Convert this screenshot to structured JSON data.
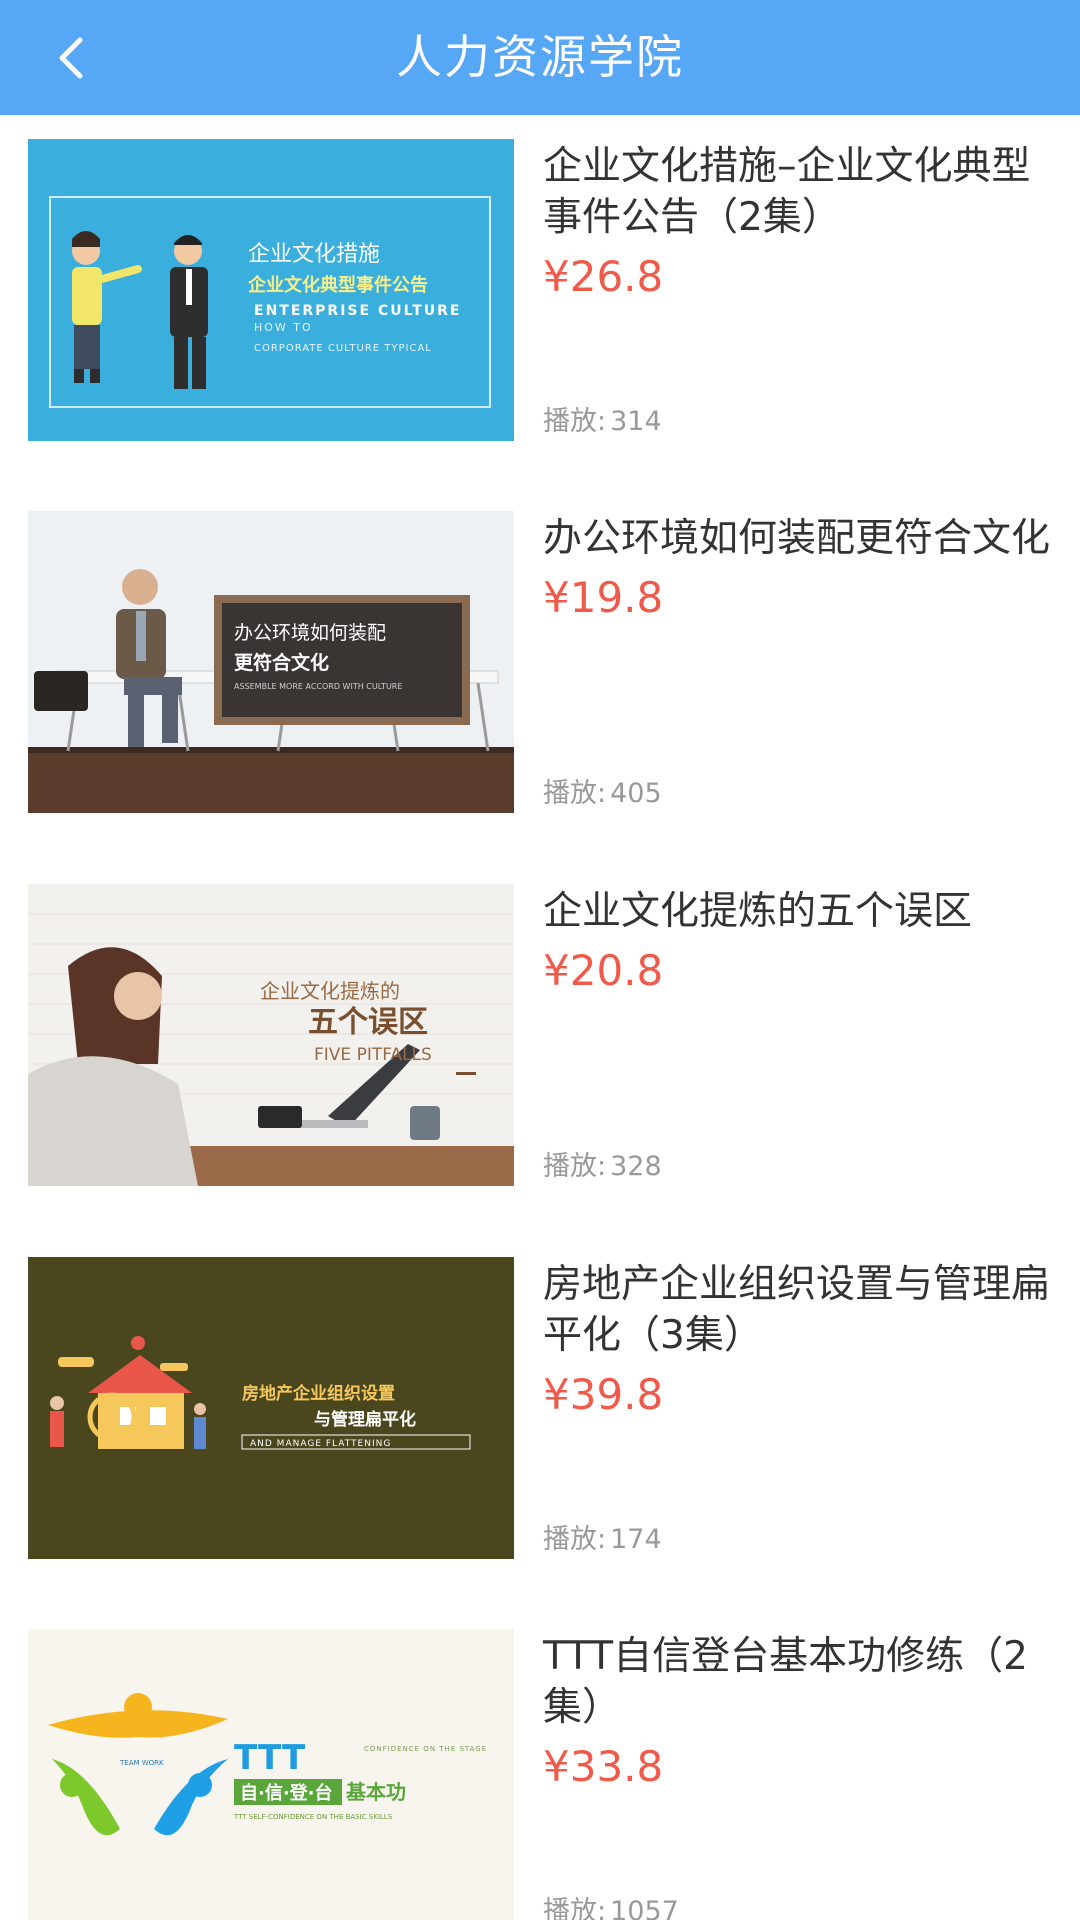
{
  "header": {
    "title": "人力资源学院",
    "back_icon": "chevron-left-icon",
    "background": "#57a7f7"
  },
  "play_label": "播放:",
  "price_color": "#f05a4a",
  "courses": [
    {
      "title": "企业文化措施–企业文化典型事件公告（2集）",
      "price": "¥26.8",
      "plays": "314",
      "thumb_text": {
        "line1": "企业文化措施",
        "line2": "企业文化典型事件公告",
        "line3": "ENTERPRISE CULTURE",
        "line4": "HOW TO",
        "line5": "CORPORATE CULTURE TYPICAL"
      }
    },
    {
      "title": "办公环境如何装配更符合文化",
      "price": "¥19.8",
      "plays": "405",
      "thumb_text": {
        "line1": "办公环境如何装配",
        "line2": "更符合文化",
        "line3": "ASSEMBLE MORE ACCORD WITH CULTURE"
      }
    },
    {
      "title": "企业文化提炼的五个误区",
      "price": "¥20.8",
      "plays": "328",
      "thumb_text": {
        "line1": "企业文化提炼的",
        "line2": "五个误区",
        "line3": "FIVE PITFALLS"
      }
    },
    {
      "title": "房地产企业组织设置与管理扁平化（3集）",
      "price": "¥39.8",
      "plays": "174",
      "thumb_text": {
        "line1": "房地产企业组织设置",
        "line2": "与管理扁平化",
        "line3": "AND MANAGE FLATTENING"
      }
    },
    {
      "title": "TTT自信登台基本功修练（2集）",
      "price": "¥33.8",
      "plays": "1057",
      "thumb_text": {
        "line1": "TTT",
        "line2": "自·信·登·台",
        "line3": "基本功",
        "line4": "TTT SELF-CONFIDENCE ON THE BASIC SKILLS",
        "line5": "CONFIDENCE ON THE STAGE",
        "line6": "TEAM WORK"
      }
    }
  ]
}
